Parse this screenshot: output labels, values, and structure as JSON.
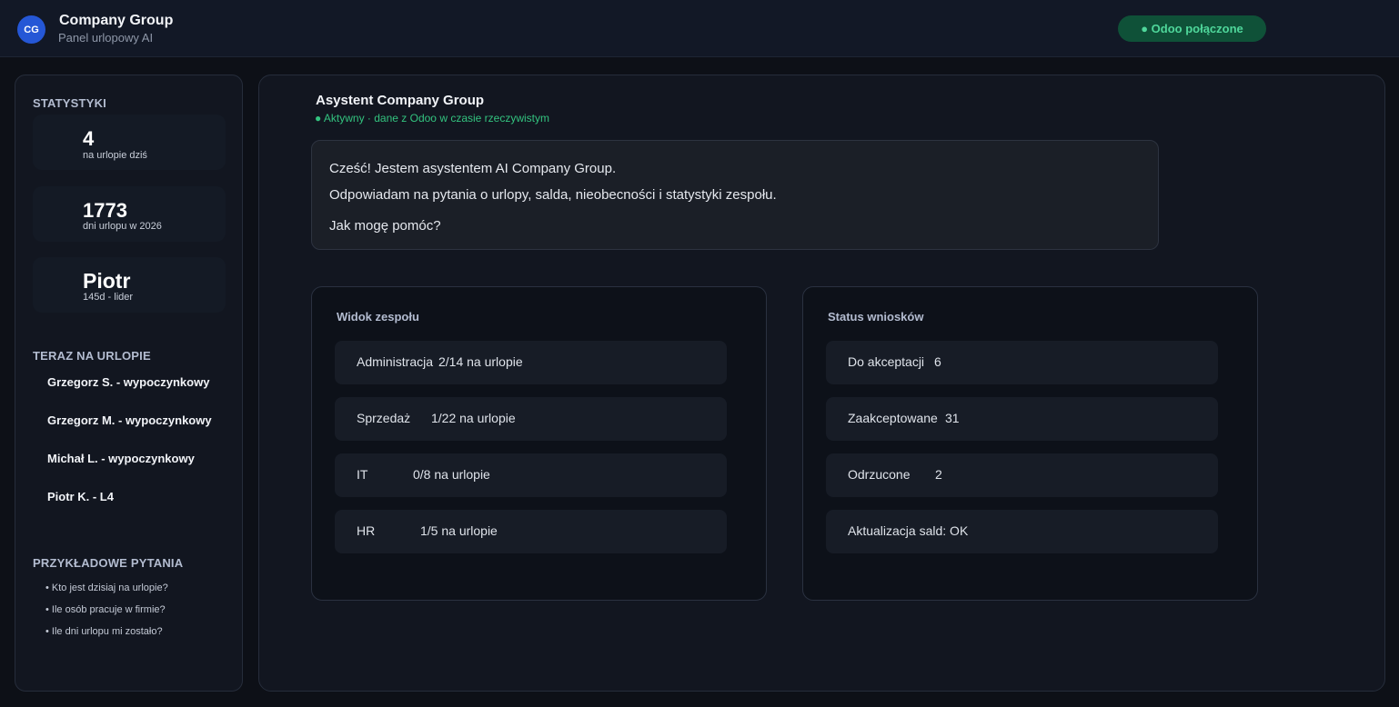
{
  "header": {
    "logo_text": "CG",
    "title": "Company Group",
    "subtitle": "Panel urlopowy AI",
    "status": "● Odoo połączone"
  },
  "sidebar": {
    "stats_title": "STATYSTYKI",
    "stats": [
      {
        "value": "4",
        "label": "na urlopie dziś"
      },
      {
        "value": "1773",
        "label": "dni urlopu w 2026"
      },
      {
        "value": "Piotr",
        "label": "145d - lider"
      }
    ],
    "on_leave_title": "TERAZ NA URLOPIE",
    "on_leave": [
      "Grzegorz S. - wypoczynkowy",
      "Grzegorz M. - wypoczynkowy",
      "Michał L. - wypoczynkowy",
      "Piotr K. - L4"
    ],
    "questions_title": "PRZYKŁADOWE PYTANIA",
    "questions": [
      "• Kto jest dzisiaj na urlopie?",
      "• Ile osób pracuje w firmie?",
      "• Ile dni urlopu mi zostało?"
    ]
  },
  "assistant": {
    "title": "Asystent Company Group",
    "status": "● Aktywny · dane z Odoo w czasie rzeczywistym",
    "messages": [
      "Cześć! Jestem asystentem AI Company Group.",
      "Odpowiadam na pytania o urlopy, salda, nieobecności i statystyki zespołu.",
      "Jak mogę pomóc?"
    ]
  },
  "team_panel": {
    "title": "Widok zespołu",
    "rows": [
      {
        "name": "Administracja",
        "value": "2/14 na urlopie"
      },
      {
        "name": "Sprzedaż",
        "value": "1/22 na urlopie"
      },
      {
        "name": "IT",
        "value": "0/8 na urlopie"
      },
      {
        "name": "HR",
        "value": "1/5 na urlopie"
      }
    ]
  },
  "requests_panel": {
    "title": "Status wniosków",
    "rows": [
      {
        "name": "Do akceptacji",
        "value": "6"
      },
      {
        "name": "Zaakceptowane",
        "value": "31"
      },
      {
        "name": "Odrzucone",
        "value": "2"
      },
      {
        "name": "Aktualizacja sald: OK",
        "value": ""
      }
    ]
  },
  "colors": {
    "accent": "#2557d6",
    "success": "#33c37f",
    "background": "#0d1017"
  }
}
